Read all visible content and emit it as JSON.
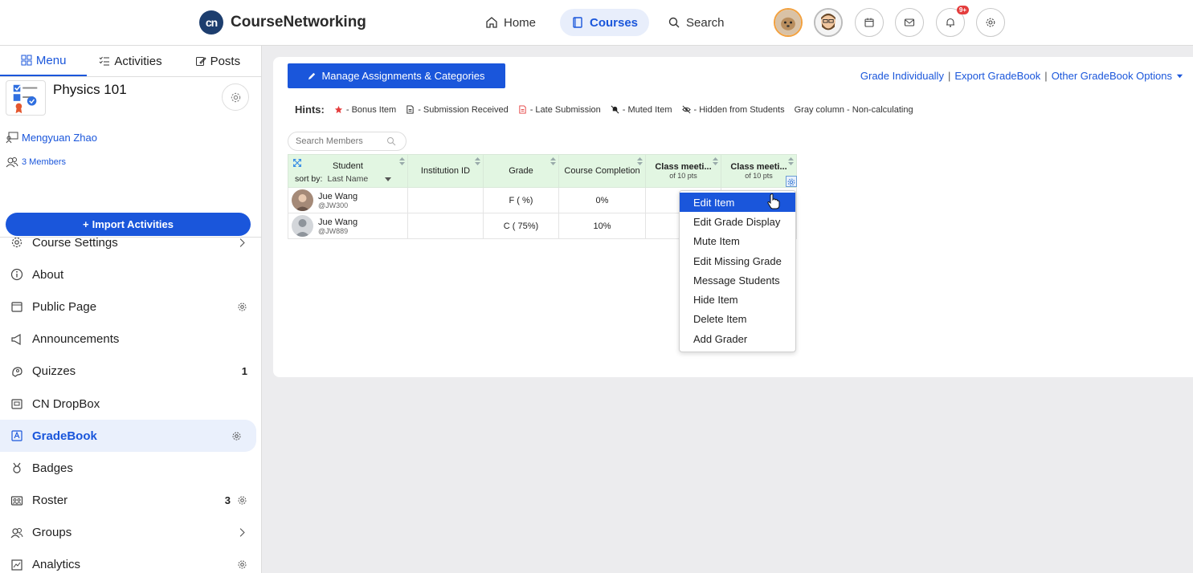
{
  "app": {
    "logo_mark": "cn",
    "name": "CourseNetworking"
  },
  "topnav": {
    "home": "Home",
    "courses": "Courses",
    "search": "Search",
    "notifications_badge": "9+"
  },
  "sidebar": {
    "tabs": {
      "menu": "Menu",
      "activities": "Activities",
      "posts": "Posts"
    },
    "course_name": "Physics 101",
    "instructor": "Mengyuan Zhao",
    "members": "3 Members",
    "import_button": "Import Activities",
    "items": [
      {
        "label": "Course Settings",
        "icon": "gear-icon",
        "right": "chevron"
      },
      {
        "label": "About",
        "icon": "info-icon",
        "right": ""
      },
      {
        "label": "Public Page",
        "icon": "calendar-icon",
        "right": "gear"
      },
      {
        "label": "Announcements",
        "icon": "megaphone-icon",
        "right": ""
      },
      {
        "label": "Quizzes",
        "icon": "quiz-icon",
        "right": "1"
      },
      {
        "label": "CN DropBox",
        "icon": "dropbox-icon",
        "right": ""
      },
      {
        "label": "GradeBook",
        "icon": "gradebook-icon",
        "right": "gear",
        "active": true
      },
      {
        "label": "Badges",
        "icon": "badge-icon",
        "right": ""
      },
      {
        "label": "Roster",
        "icon": "roster-icon",
        "right": "3"
      },
      {
        "label": "Groups",
        "icon": "groups-icon",
        "right": "chevron"
      },
      {
        "label": "Analytics",
        "icon": "analytics-icon",
        "right": "gear"
      }
    ]
  },
  "gradebook": {
    "manage_button": "Manage Assignments & Categories",
    "links": {
      "grade_individually": "Grade Individually",
      "export": "Export GradeBook",
      "other": "Other GradeBook Options"
    },
    "hints": {
      "label": "Hints:",
      "bonus": "- Bonus Item",
      "submission": "- Submission Received",
      "late": "- Late Submission",
      "muted": "- Muted Item",
      "hidden": "- Hidden from Students",
      "gray": "Gray column - Non-calculating"
    },
    "search_placeholder": "Search Members",
    "columns": {
      "student": "Student",
      "sort_by": "sort by:",
      "sort_value": "Last Name",
      "institution": "Institution ID",
      "grade": "Grade",
      "completion": "Course Completion",
      "class1": "Class meeti...",
      "class1_sub": "of 10 pts",
      "class2": "Class meeti...",
      "class2_sub": "of 10 pts"
    },
    "rows": [
      {
        "name": "Jue Wang",
        "handle": "@JW300",
        "institution": "",
        "grade": "F ( %)",
        "completion": "0%"
      },
      {
        "name": "Jue Wang",
        "handle": "@JW889",
        "institution": "",
        "grade": "C ( 75%)",
        "completion": "10%"
      }
    ],
    "context_menu": [
      "Edit Item",
      "Edit Grade Display",
      "Mute Item",
      "Edit Missing Grade",
      "Message Students",
      "Hide Item",
      "Delete Item",
      "Add Grader"
    ]
  },
  "colors": {
    "accent": "#1a56db",
    "header_green": "#e2f6e2",
    "badge_red": "#e43d3d"
  }
}
